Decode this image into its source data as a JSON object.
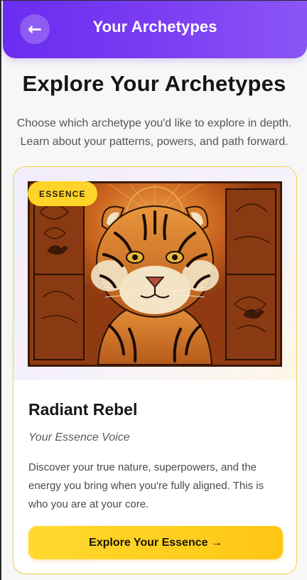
{
  "header": {
    "back_icon": "arrow-left-icon",
    "back_glyph": "←",
    "title": "Your Archetypes"
  },
  "main": {
    "heading": "Explore Your Archetypes",
    "intro": "Choose which archetype you'd like to explore in depth. Learn about your patterns, powers, and path forward."
  },
  "card": {
    "badge": "ESSENCE",
    "image_subject": "tiger-illustration",
    "title": "Radiant Rebel",
    "subtitle": "Your Essence Voice",
    "description": "Discover your true nature, superpowers, and the energy you bring when you're fully aligned. This is who you are at your core.",
    "cta_label": "Explore Your Essence →"
  },
  "colors": {
    "header_gradient_start": "#6a2cf0",
    "header_gradient_end": "#8b55f5",
    "accent_yellow": "#ffd42a",
    "card_border": "#f5cf45"
  }
}
